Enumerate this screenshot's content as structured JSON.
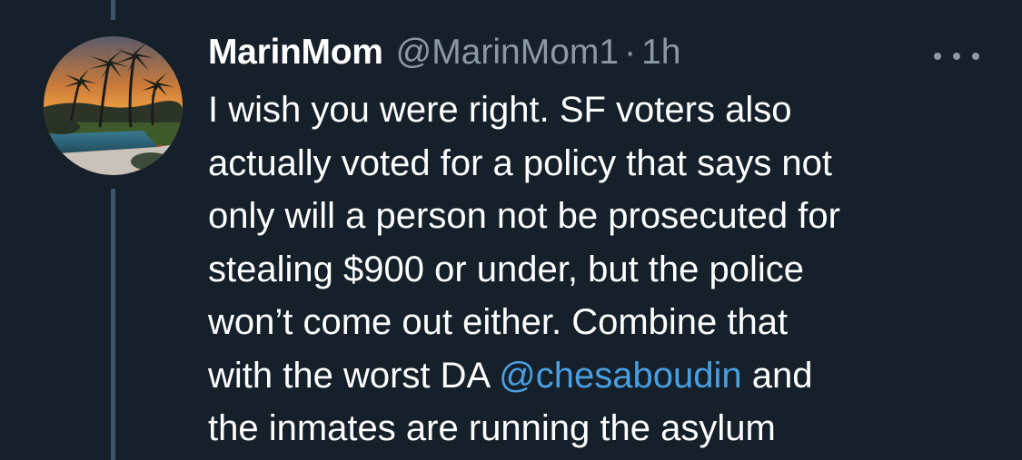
{
  "tweet": {
    "display_name": "MarinMom",
    "handle": "@MarinMom1",
    "separator": "·",
    "time": "1h",
    "body_lines": [
      "I wish you were right. SF voters also",
      "actually voted for a policy that says not",
      "only will a person not be prosecuted for",
      "stealing $900 or under, but the police",
      "won’t come out either. Combine that"
    ],
    "line6_prefix": "with the worst DA ",
    "mention": "@chesaboudin",
    "line6_suffix": " and",
    "line7": "the inmates are running the asylum"
  },
  "icons": {
    "avatar": "sunset-palm-trees-photo",
    "more": "more-options-icon"
  },
  "colors": {
    "background": "#15202b",
    "text": "#ffffff",
    "secondary": "#8b98a5",
    "link": "#4a9fe0",
    "thread_line": "#3d5466"
  }
}
